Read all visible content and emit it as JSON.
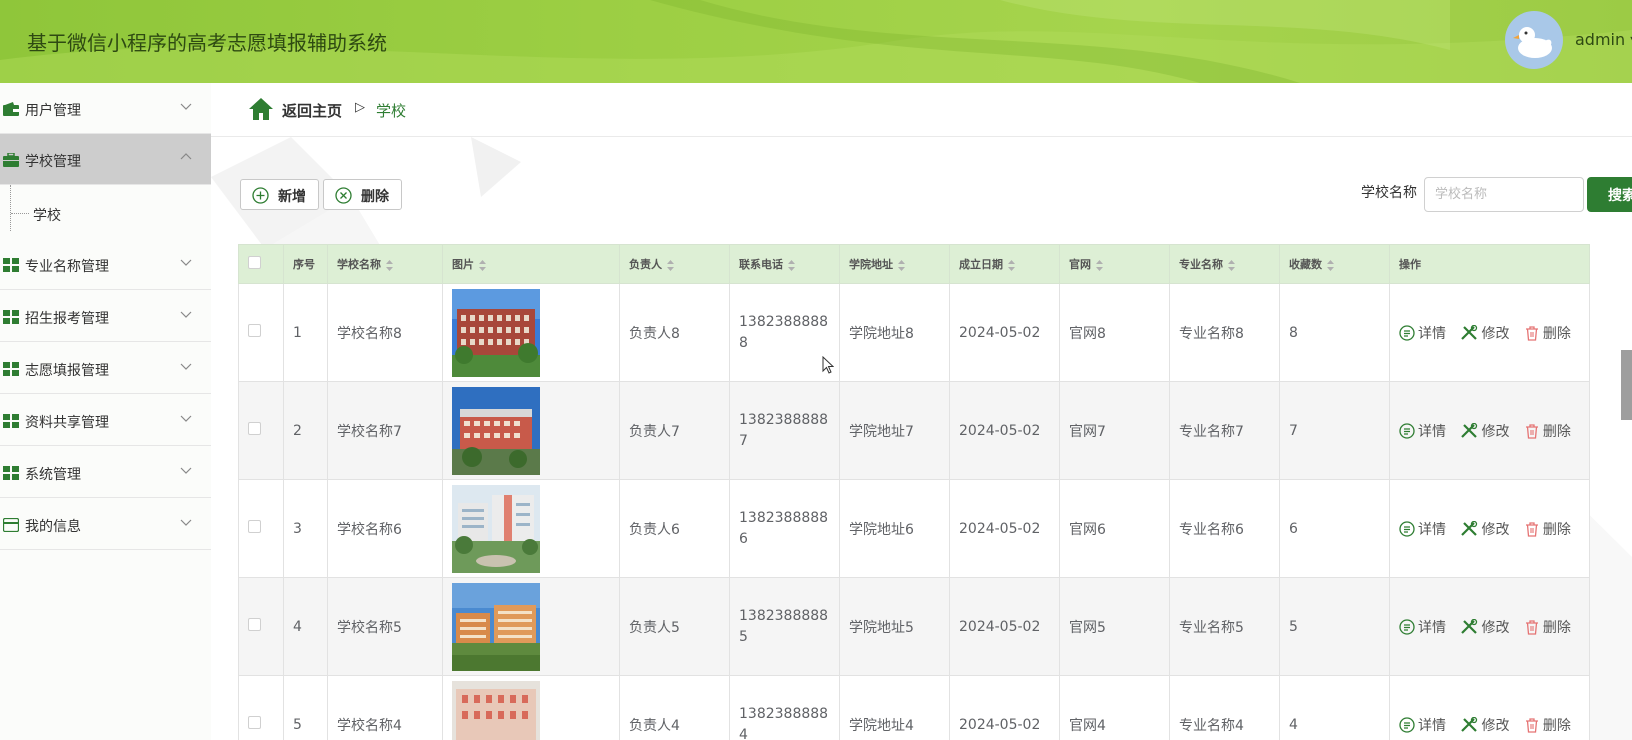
{
  "header": {
    "title": "基于微信小程序的高考志愿填报辅助系统",
    "user": "admin ▾"
  },
  "sidebar": {
    "items": [
      {
        "label": "用户管理",
        "icon": "wallet-icon"
      },
      {
        "label": "学校管理",
        "icon": "briefcase-icon",
        "active": true
      },
      {
        "label": "专业名称管理",
        "icon": "grid-icon"
      },
      {
        "label": "招生报考管理",
        "icon": "grid-icon"
      },
      {
        "label": "志愿填报管理",
        "icon": "grid-icon"
      },
      {
        "label": "资料共享管理",
        "icon": "grid-icon"
      },
      {
        "label": "系统管理",
        "icon": "grid-icon"
      },
      {
        "label": "我的信息",
        "icon": "card-icon"
      }
    ],
    "sub_item": "学校"
  },
  "breadcrumb": {
    "home": "返回主页",
    "separator": "▷",
    "current": "学校"
  },
  "toolbar": {
    "add_label": "新增",
    "delete_label": "删除"
  },
  "search": {
    "label": "学校名称",
    "placeholder": "学校名称",
    "button": "搜索"
  },
  "table": {
    "columns": [
      "序号",
      "学校名称",
      "图片",
      "负责人",
      "联系电话",
      "学院地址",
      "成立日期",
      "官网",
      "专业名称",
      "收藏数",
      "操作"
    ],
    "rows": [
      {
        "no": "1",
        "name": "学校名称8",
        "person": "负责人8",
        "phone1": "1382388888",
        "phone2": "8",
        "addr": "学院地址8",
        "date": "2024-05-02",
        "site": "官网8",
        "major": "专业名称8",
        "fav": "8"
      },
      {
        "no": "2",
        "name": "学校名称7",
        "person": "负责人7",
        "phone1": "1382388888",
        "phone2": "7",
        "addr": "学院地址7",
        "date": "2024-05-02",
        "site": "官网7",
        "major": "专业名称7",
        "fav": "7"
      },
      {
        "no": "3",
        "name": "学校名称6",
        "person": "负责人6",
        "phone1": "1382388888",
        "phone2": "6",
        "addr": "学院地址6",
        "date": "2024-05-02",
        "site": "官网6",
        "major": "专业名称6",
        "fav": "6"
      },
      {
        "no": "4",
        "name": "学校名称5",
        "person": "负责人5",
        "phone1": "1382388888",
        "phone2": "5",
        "addr": "学院地址5",
        "date": "2024-05-02",
        "site": "官网5",
        "major": "专业名称5",
        "fav": "5"
      },
      {
        "no": "5",
        "name": "学校名称4",
        "person": "负责人4",
        "phone1": "1382388888",
        "phone2": "4",
        "addr": "学院地址4",
        "date": "2024-05-02",
        "site": "官网4",
        "major": "专业名称4",
        "fav": "4"
      }
    ],
    "actions": {
      "detail": "详情",
      "edit": "修改",
      "delete": "删除"
    }
  },
  "colors": {
    "header": "#9dcf44",
    "accent": "#2e7d32",
    "table_header": "#ddefd5",
    "danger": "#e57373"
  }
}
